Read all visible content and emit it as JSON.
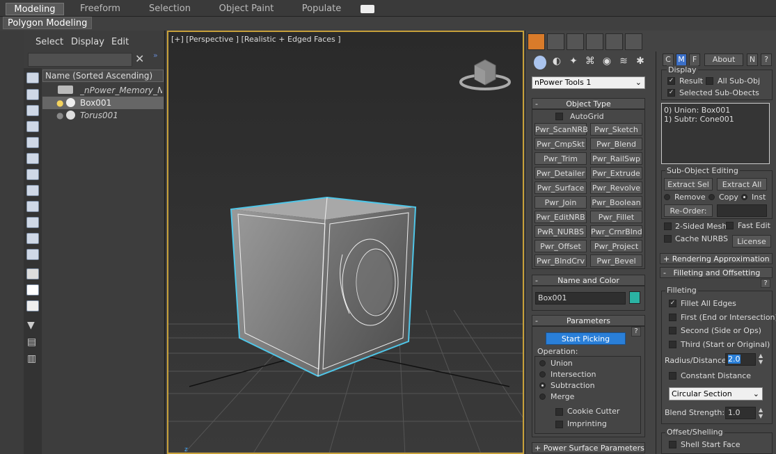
{
  "ribbon": {
    "tabs": [
      "Modeling",
      "Freeform",
      "Selection",
      "Object Paint",
      "Populate"
    ],
    "subtab": "Polygon Modeling"
  },
  "explorer": {
    "menu": [
      "Select",
      "Display",
      "Edit"
    ],
    "column_header": "Name (Sorted Ascending)",
    "rows": [
      "_nPower_Memory_N",
      "Box001",
      "Torus001"
    ]
  },
  "viewport": {
    "label": "[+] [Perspective ] [Realistic + Edged Faces ]",
    "axis_z": "z"
  },
  "create_panel": {
    "dropdown": "nPower Tools 1",
    "object_type": {
      "title": "Object Type",
      "autogrid": "AutoGrid",
      "buttons": [
        "Pwr_ScanNRB",
        "Pwr_Sketch",
        "Pwr_CmpSkt",
        "Pwr_Blend",
        "Pwr_Trim",
        "Pwr_RailSwp",
        "Pwr_Detailer",
        "Pwr_Extrude",
        "Pwr_Surface",
        "Pwr_Revolve",
        "Pwr_Join",
        "Pwr_Boolean",
        "Pwr_EditNRB",
        "Pwr_Fillet",
        "PwR_NURBS",
        "Pwr_CrnrBlnd",
        "Pwr_Offset",
        "Pwr_Project",
        "Pwr_BlndCrv",
        "Pwr_Bevel"
      ]
    },
    "name_color": {
      "title": "Name and Color",
      "name": "Box001",
      "color": "#2bb3a3"
    },
    "parameters": {
      "title": "Parameters",
      "start_picking": "Start Picking",
      "help": "?",
      "operation_label": "Operation:",
      "operations": [
        "Union",
        "Intersection",
        "Subtraction",
        "Merge"
      ],
      "selected": "Subtraction",
      "cookie_cutter": "Cookie Cutter",
      "imprinting": "Imprinting"
    },
    "power_surface": "+ Power Surface Parameters"
  },
  "modifier_panel": {
    "tabs": [
      "C",
      "M",
      "F",
      "About",
      "N",
      "?"
    ],
    "display": {
      "title": "Display",
      "result": "Result",
      "all_subobj": "All Sub-Obj",
      "selected_subobj": "Selected Sub-Obects"
    },
    "list": [
      "0) Union: Box001",
      "1) Subtr: Cone001"
    ],
    "subobj_editing": {
      "title": "Sub-Object Editing",
      "extract_sel": "Extract Sel",
      "extract_all": "Extract All",
      "remove": "Remove",
      "copy": "Copy",
      "inst": "Inst",
      "reorder": "Re-Order:",
      "two_sided": "2-Sided Mesh",
      "fast_edit": "Fast Edit",
      "cache_nurbs": "Cache NURBS",
      "license": "License"
    },
    "rendering_approx": "Rendering Approximation",
    "filleting_offsetting": "Filleting and Offsetting",
    "filleting": {
      "title": "Filleting",
      "fillet_all": "Fillet All Edges",
      "first": "First (End or Intersection)",
      "second": "Second (Side or Ops)",
      "third": "Third (Start or Original)",
      "radius_label": "Radius/Distance:",
      "radius_value": "2.0",
      "constant_distance": "Constant Distance",
      "section": "Circular Section",
      "blend_label": "Blend Strength:",
      "blend_value": "1.0"
    },
    "offset_shelling": {
      "title": "Offset/Shelling",
      "shell_start": "Shell Start Face"
    }
  }
}
